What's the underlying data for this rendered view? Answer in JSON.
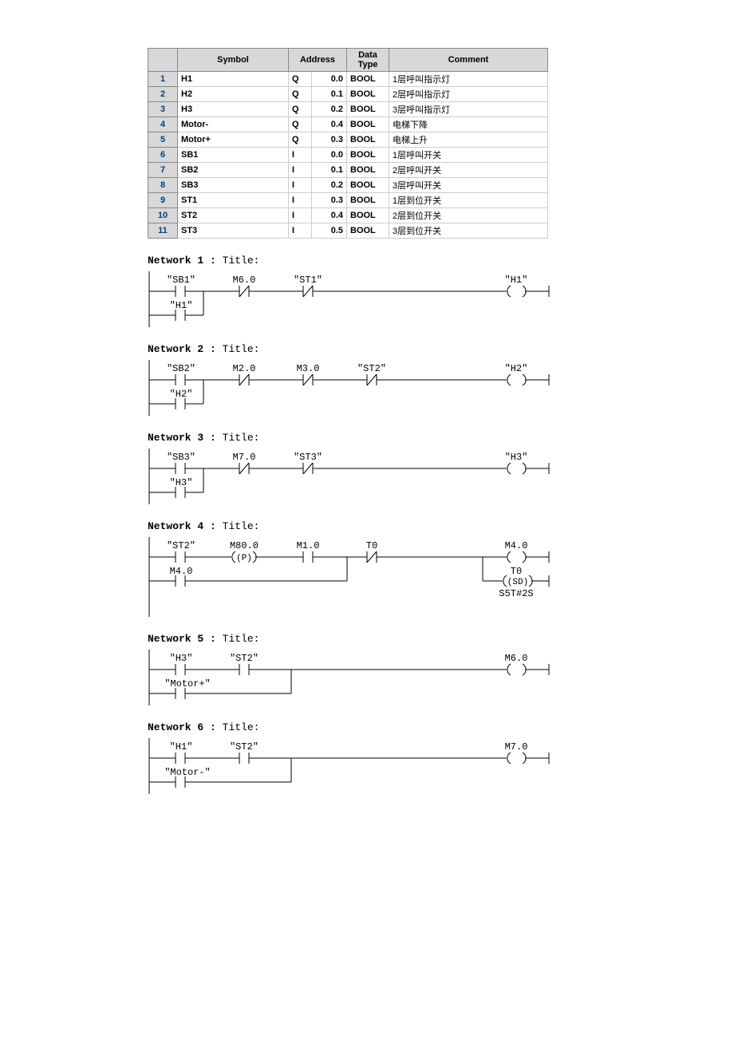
{
  "table": {
    "headers": [
      "",
      "Symbol",
      "Address",
      "Data Type",
      "Comment"
    ],
    "rows": [
      {
        "n": "1",
        "sym": "H1",
        "a1": "Q",
        "a2": "0.0",
        "dt": "BOOL",
        "cm": "1层呼叫指示灯"
      },
      {
        "n": "2",
        "sym": "H2",
        "a1": "Q",
        "a2": "0.1",
        "dt": "BOOL",
        "cm": "2层呼叫指示灯"
      },
      {
        "n": "3",
        "sym": "H3",
        "a1": "Q",
        "a2": "0.2",
        "dt": "BOOL",
        "cm": "3层呼叫指示灯"
      },
      {
        "n": "4",
        "sym": "Motor-",
        "a1": "Q",
        "a2": "0.4",
        "dt": "BOOL",
        "cm": "电梯下降"
      },
      {
        "n": "5",
        "sym": "Motor+",
        "a1": "Q",
        "a2": "0.3",
        "dt": "BOOL",
        "cm": "电梯上升"
      },
      {
        "n": "6",
        "sym": "SB1",
        "a1": "I",
        "a2": "0.0",
        "dt": "BOOL",
        "cm": "1层呼叫开关"
      },
      {
        "n": "7",
        "sym": "SB2",
        "a1": "I",
        "a2": "0.1",
        "dt": "BOOL",
        "cm": "2层呼叫开关"
      },
      {
        "n": "8",
        "sym": "SB3",
        "a1": "I",
        "a2": "0.2",
        "dt": "BOOL",
        "cm": "3层呼叫开关"
      },
      {
        "n": "9",
        "sym": "ST1",
        "a1": "I",
        "a2": "0.3",
        "dt": "BOOL",
        "cm": "1层到位开关"
      },
      {
        "n": "10",
        "sym": "ST2",
        "a1": "I",
        "a2": "0.4",
        "dt": "BOOL",
        "cm": "2层到位开关"
      },
      {
        "n": "11",
        "sym": "ST3",
        "a1": "I",
        "a2": "0.5",
        "dt": "BOOL",
        "cm": "3层到位开关"
      }
    ]
  },
  "net1": {
    "title": "Network 1 :",
    "sub": "Title:",
    "c": [
      "\"SB1\"",
      "M6.0",
      "\"ST1\"",
      "\"H1\"",
      "\"H1\""
    ]
  },
  "net2": {
    "title": "Network 2 :",
    "sub": "Title:",
    "c": [
      "\"SB2\"",
      "M2.0",
      "M3.0",
      "\"ST2\"",
      "\"H2\"",
      "\"H2\""
    ]
  },
  "net3": {
    "title": "Network 3 :",
    "sub": "Title:",
    "c": [
      "\"SB3\"",
      "M7.0",
      "\"ST3\"",
      "\"H3\"",
      "\"H3\""
    ]
  },
  "net4": {
    "title": "Network 4 :",
    "sub": "Title:",
    "c": [
      "\"ST2\"",
      "M80.0",
      "M1.0",
      "T0",
      "M4.0",
      "M4.0",
      "T0",
      "(SD)",
      "S5T#2S",
      "(P)"
    ]
  },
  "net5": {
    "title": "Network 5 :",
    "sub": "Title:",
    "c": [
      "\"H3\"",
      "\"ST2\"",
      "M6.0",
      "\"Motor+\""
    ]
  },
  "net6": {
    "title": "Network 6 :",
    "sub": "Title:",
    "c": [
      "\"H1\"",
      "\"ST2\"",
      "M7.0",
      "\"Motor-\""
    ]
  }
}
